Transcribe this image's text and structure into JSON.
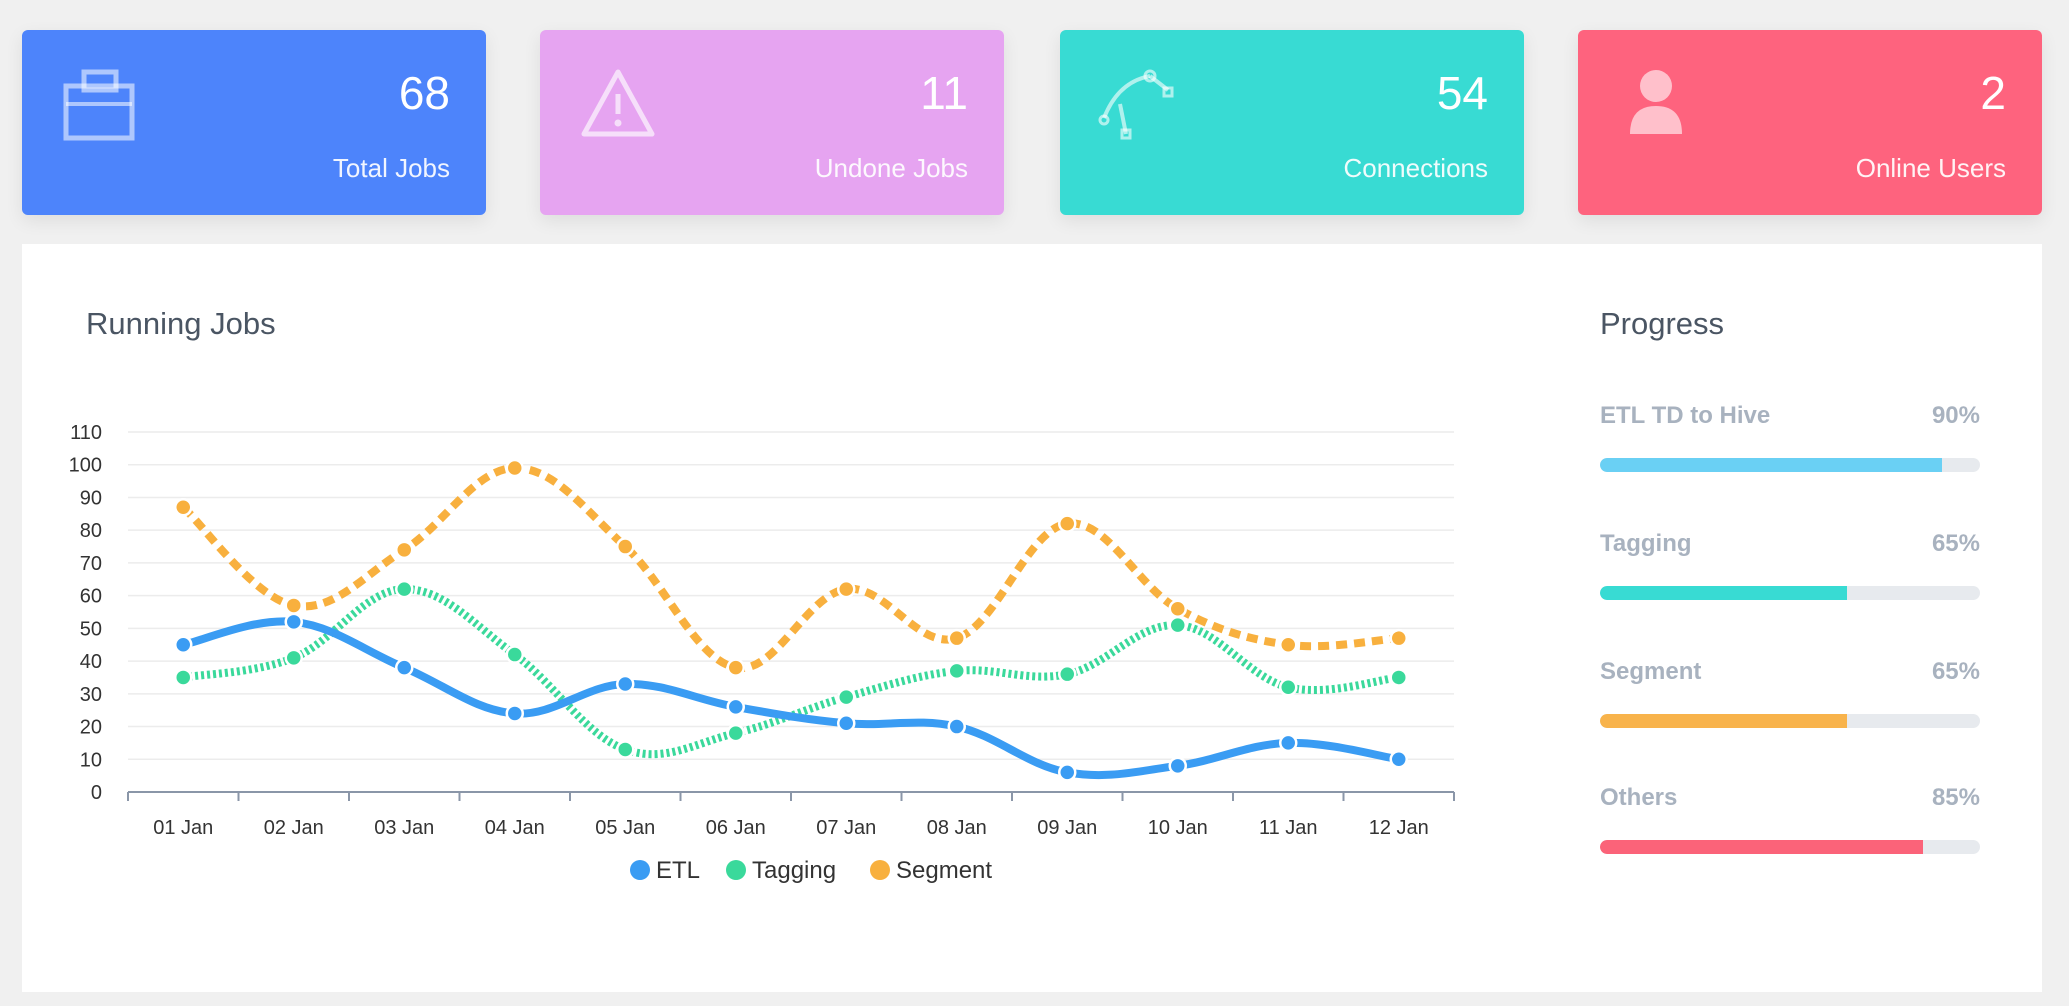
{
  "stats": [
    {
      "value": "68",
      "label": "Total Jobs",
      "color": "#4d84fb",
      "icon": "briefcase-icon"
    },
    {
      "value": "11",
      "label": "Undone Jobs",
      "color": "#e6a4f1",
      "icon": "warning-icon"
    },
    {
      "value": "54",
      "label": "Connections",
      "color": "#38dbd3",
      "icon": "bezier-connection-icon"
    },
    {
      "value": "2",
      "label": "Online Users",
      "color": "#fe637e",
      "icon": "user-icon"
    }
  ],
  "running_jobs": {
    "title": "Running Jobs"
  },
  "progress": {
    "title": "Progress",
    "items": [
      {
        "name": "ETL TD to Hive",
        "percent_text": "90%",
        "value": 0.9,
        "color": "#6ad0f4"
      },
      {
        "name": "Tagging",
        "percent_text": "65%",
        "value": 0.65,
        "color": "#38dbd3"
      },
      {
        "name": "Segment",
        "percent_text": "65%",
        "value": 0.65,
        "color": "#f8b34b"
      },
      {
        "name": "Others",
        "percent_text": "85%",
        "value": 0.85,
        "color": "#fb6379"
      }
    ]
  },
  "chart_data": {
    "type": "line",
    "title": "Running Jobs",
    "categories": [
      "01 Jan",
      "02 Jan",
      "03 Jan",
      "04 Jan",
      "05 Jan",
      "06 Jan",
      "07 Jan",
      "08 Jan",
      "09 Jan",
      "10 Jan",
      "11 Jan",
      "12 Jan"
    ],
    "ylim": [
      0,
      110
    ],
    "yticks": [
      0,
      10,
      20,
      30,
      40,
      50,
      60,
      70,
      80,
      90,
      100,
      110
    ],
    "grid": true,
    "legend_position": "bottom",
    "series": [
      {
        "name": "ETL",
        "color": "#3a9cf3",
        "style": "solid",
        "values": [
          45,
          52,
          38,
          24,
          33,
          26,
          21,
          20,
          6,
          8,
          15,
          10
        ]
      },
      {
        "name": "Tagging",
        "color": "#3ad99b",
        "style": "dotted",
        "values": [
          35,
          41,
          62,
          42,
          13,
          18,
          29,
          37,
          36,
          51,
          32,
          35
        ]
      },
      {
        "name": "Segment",
        "color": "#f8b03e",
        "style": "dashed",
        "values": [
          87,
          57,
          74,
          99,
          75,
          38,
          62,
          47,
          82,
          56,
          45,
          47
        ]
      }
    ]
  }
}
